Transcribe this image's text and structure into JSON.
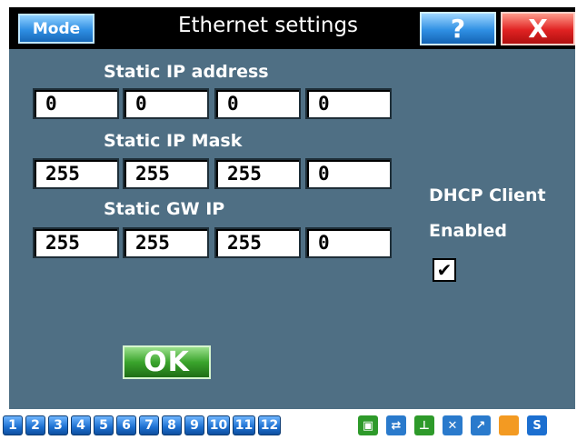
{
  "titlebar": {
    "mode_label": "Mode",
    "title": "Ethernet settings",
    "help_label": "?",
    "close_label": "X"
  },
  "static_ip": {
    "label": "Static IP address",
    "octets": [
      "0",
      "0",
      "0",
      "0"
    ]
  },
  "static_mask": {
    "label": "Static IP Mask",
    "octets": [
      "255",
      "255",
      "255",
      "0"
    ]
  },
  "static_gw": {
    "label": "Static GW IP",
    "octets": [
      "255",
      "255",
      "255",
      "0"
    ]
  },
  "dhcp": {
    "label_line1": "DHCP Client",
    "label_line2": "Enabled",
    "checked": true
  },
  "ok_label": "OK",
  "toolbar": {
    "numbers": [
      "1",
      "2",
      "3",
      "4",
      "5",
      "6",
      "7",
      "8",
      "9",
      "10",
      "11",
      "12"
    ],
    "icons": [
      {
        "name": "lock-icon",
        "color": "#2e9a2a"
      },
      {
        "name": "network-icon",
        "color": "#2a7acc"
      },
      {
        "name": "thermometer-icon",
        "color": "#2e9a2a"
      },
      {
        "name": "disconnect-icon",
        "color": "#2a7acc"
      },
      {
        "name": "chart-icon",
        "color": "#2a7acc"
      },
      {
        "name": "orange-square-icon",
        "color": "#f39a22"
      },
      {
        "name": "s-icon",
        "color": "#1c6fd0",
        "label": "S"
      }
    ]
  },
  "colors": {
    "panel": "#4f6f84",
    "titlebar": "#000000"
  }
}
